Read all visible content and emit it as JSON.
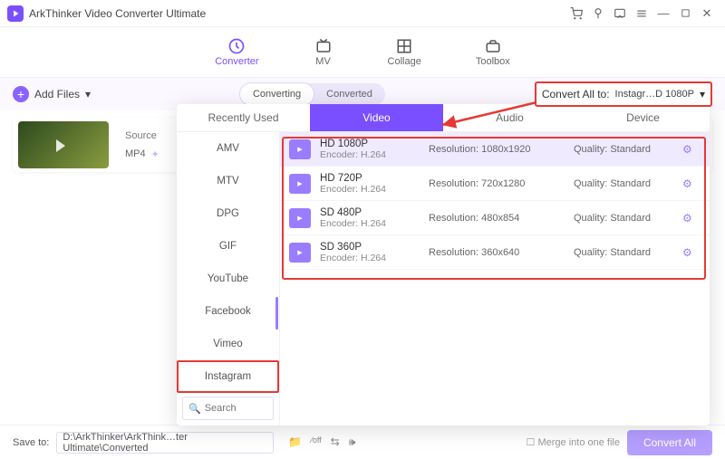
{
  "app": {
    "title": "ArkThinker Video Converter Ultimate"
  },
  "nav": {
    "converter": "Converter",
    "mv": "MV",
    "collage": "Collage",
    "toolbox": "Toolbox"
  },
  "topbar": {
    "addfiles": "Add Files",
    "converting": "Converting",
    "converted": "Converted",
    "convertall_label": "Convert All to:",
    "convertall_value": "Instagr…D 1080P"
  },
  "filerow": {
    "source_label": "Source",
    "format": "MP4"
  },
  "popup": {
    "tabs": {
      "recent": "Recently Used",
      "video": "Video",
      "audio": "Audio",
      "device": "Device"
    },
    "categories": [
      "AMV",
      "MTV",
      "DPG",
      "GIF",
      "YouTube",
      "Facebook",
      "Vimeo",
      "Instagram"
    ],
    "selected_category": "Instagram",
    "search_placeholder": "Search",
    "formats": [
      {
        "name": "HD 1080P",
        "encoder": "Encoder: H.264",
        "resolution": "Resolution: 1080x1920",
        "quality": "Quality: Standard",
        "selected": true
      },
      {
        "name": "HD 720P",
        "encoder": "Encoder: H.264",
        "resolution": "Resolution: 720x1280",
        "quality": "Quality: Standard",
        "selected": false
      },
      {
        "name": "SD 480P",
        "encoder": "Encoder: H.264",
        "resolution": "Resolution: 480x854",
        "quality": "Quality: Standard",
        "selected": false
      },
      {
        "name": "SD 360P",
        "encoder": "Encoder: H.264",
        "resolution": "Resolution: 360x640",
        "quality": "Quality: Standard",
        "selected": false
      }
    ]
  },
  "bottom": {
    "saveto_label": "Save to:",
    "saveto_path": "D:\\ArkThinker\\ArkThink…ter Ultimate\\Converted",
    "merge_label": "Merge into one file",
    "convert_btn": "Convert All"
  }
}
